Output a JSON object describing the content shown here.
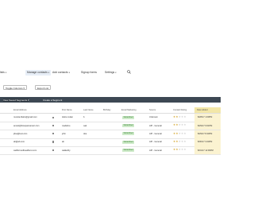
{
  "nav": {
    "items": [
      {
        "label": "lists",
        "caret": "▾"
      },
      {
        "label": "Manage contacts",
        "caret": "▾"
      },
      {
        "label": "Add contacts",
        "caret": "▾"
      },
      {
        "label": "Signup forms",
        "caret": ""
      },
      {
        "label": "Settings",
        "caret": "▾"
      }
    ]
  },
  "toolbar": {
    "toggle_columns": "Toggle Columns ▾",
    "export_list": "Export List"
  },
  "tabs": {
    "view_saved": "View Saved Segments ▾",
    "create_segment": "Create a Segment"
  },
  "table": {
    "headers": [
      "Email Address",
      "First Name",
      "Last Name",
      "Birthday",
      "Email Marketing",
      "Source",
      "Contact Rating",
      "Date Added"
    ],
    "rows": [
      {
        "email": "mvania.blairs@gmail.com",
        "first": "dulce.mulan",
        "last": "b",
        "status": "Subscribed",
        "source": "Unknown",
        "rating": 2,
        "date": "8/28/17 1:00PM"
      },
      {
        "email": "amoel@fewspamanswr.com",
        "first": "madeline",
        "last": "oak",
        "status": "Subscribed",
        "source": "API - General",
        "rating": 2,
        "date": "8/29/17 6:01PM"
      },
      {
        "email": "jdoe@test.com",
        "first": "john",
        "last": "doe",
        "status": "Subscribed",
        "source": "API - General",
        "rating": 2,
        "date": "8/29/17 8:44PM"
      },
      {
        "email": "ab@ab.com",
        "first": "ab",
        "last": "",
        "status": "Subscribed",
        "source": "API - General",
        "rating": 2,
        "date": "8/30/17 3:24PM"
      },
      {
        "email": "wellformedheadforut.com",
        "first": "walkerlily",
        "last": "",
        "status": "Subscribed",
        "source": "API - General",
        "rating": 2,
        "date": "8/31/17 12:06PM"
      }
    ]
  },
  "colors": {
    "dark_bar": "#3d4853",
    "badge_bg": "#cdeac8",
    "star": "#d4a52a",
    "highlight_col": "#f3e7a8"
  }
}
